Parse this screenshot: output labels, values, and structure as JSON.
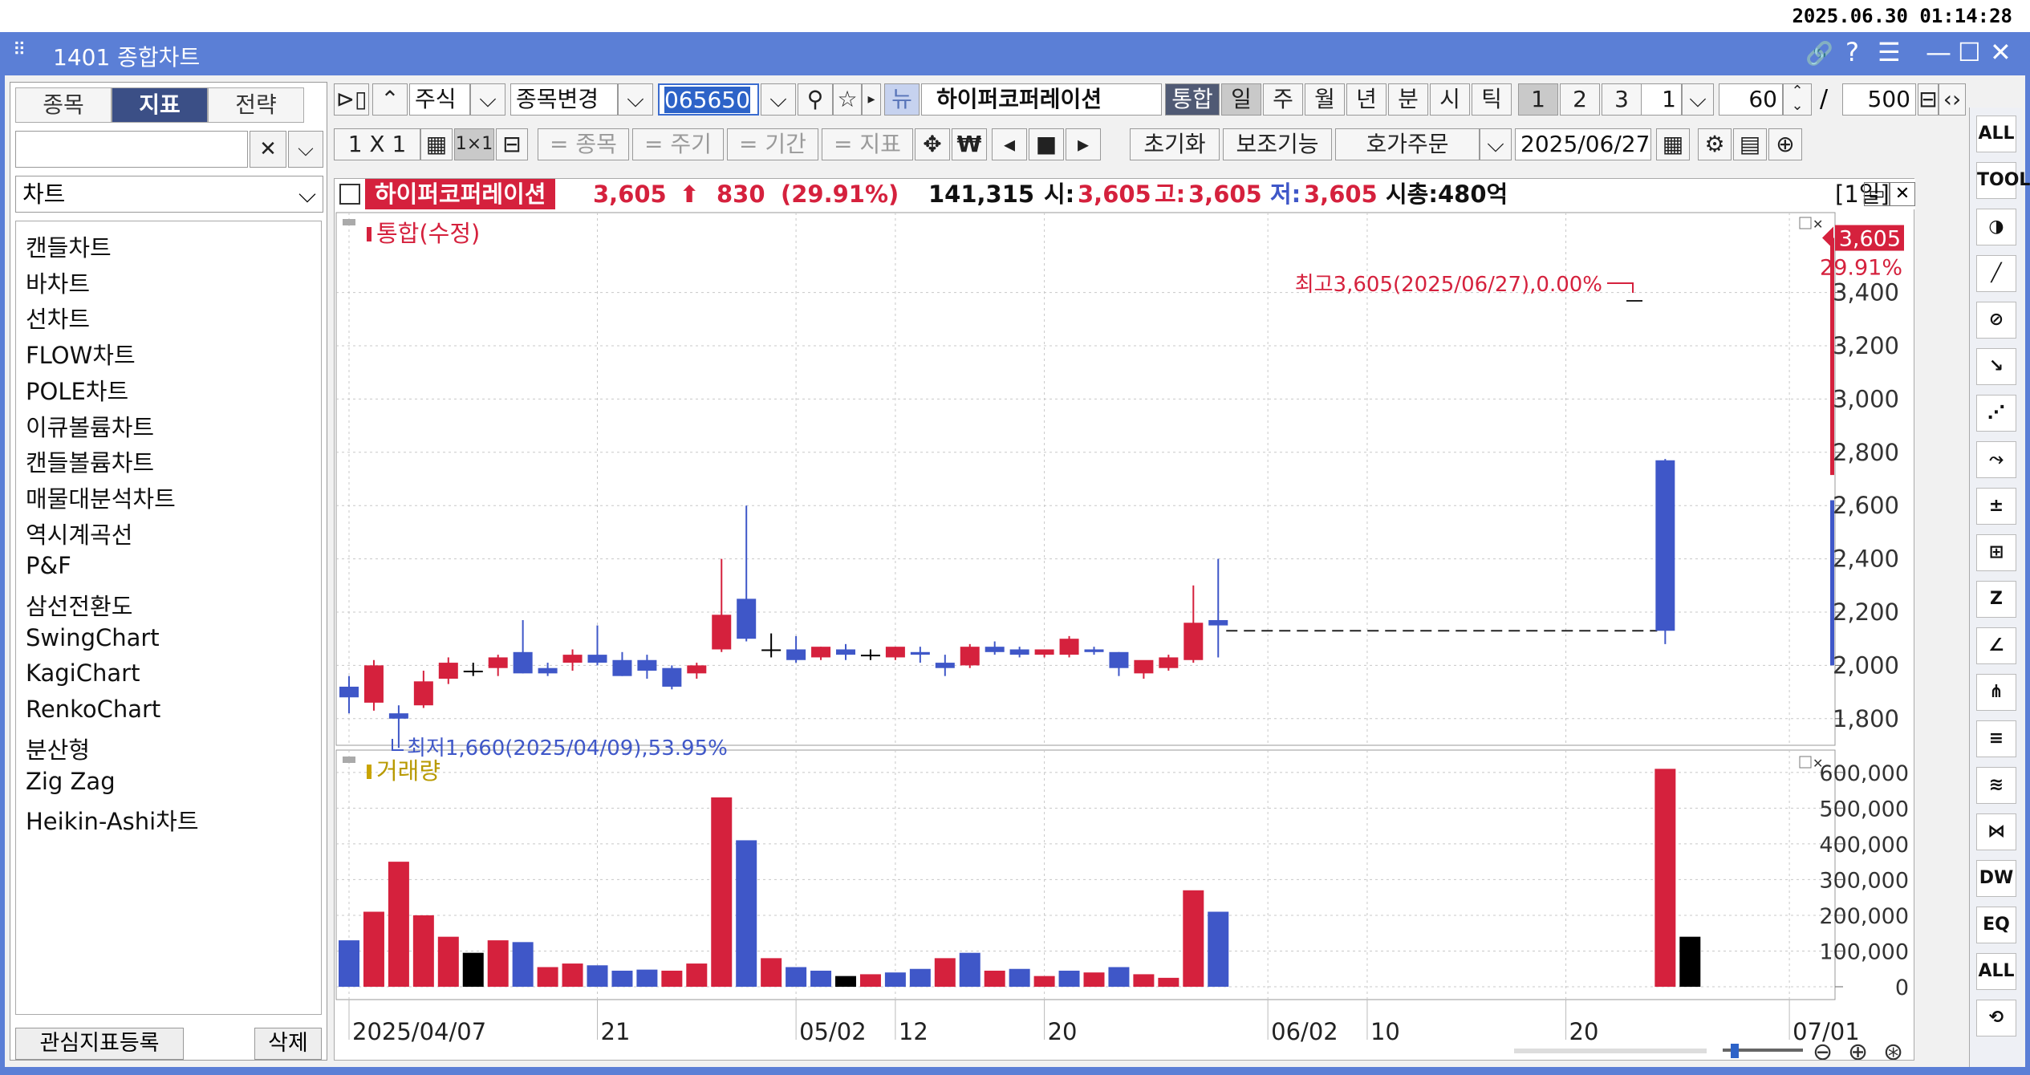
{
  "clock": "2025.06.30 01:14:28",
  "window": {
    "title": "1401 종합차트"
  },
  "left_panel": {
    "tabs": [
      {
        "label": "종목"
      },
      {
        "label": "지표"
      },
      {
        "label": "전략"
      }
    ],
    "search_value": "",
    "category": "차트",
    "chart_types": [
      "캔들차트",
      "바차트",
      "선차트",
      "FLOW차트",
      "POLE차트",
      "이큐볼륨차트",
      "캔들볼륨차트",
      "매물대분석차트",
      "역시계곡선",
      "P&F",
      "삼선전환도",
      "SwingChart",
      "KagiChart",
      "RenkoChart",
      "분산형",
      "Zig Zag",
      "Heikin-Ashi차트"
    ],
    "register_label": "관심지표등록",
    "delete_label": "삭제"
  },
  "toolbar1": {
    "market": "주식",
    "change_label": "종목변경",
    "code": "065650",
    "news": "뉴",
    "stock_name": "하이퍼코퍼레이션",
    "tonghap": "통합",
    "periods": [
      "일",
      "주",
      "월",
      "년",
      "분",
      "시",
      "틱"
    ],
    "nums": [
      "1",
      "2",
      "3"
    ],
    "count": "1",
    "span": "60",
    "slash": "/",
    "total": "500"
  },
  "toolbar2": {
    "layout": "1 X 1",
    "one": "1×1",
    "filters": [
      "종목",
      "주기",
      "기간",
      "지표"
    ],
    "won": "₩",
    "reset": "초기화",
    "aux": "보조기능",
    "order": "호가주문",
    "date": "2025/06/27"
  },
  "info": {
    "name": "하이퍼코퍼레이션",
    "price": "3,605",
    "arrow": "⬆",
    "change": "830",
    "pct": "(29.91%)",
    "volume": "141,315",
    "open_label": "시:",
    "open": "3,605",
    "high_label": "고:",
    "high": "3,605",
    "low_label": "저:",
    "low": "3,605",
    "cap": "시총:480억",
    "period": "[1일]"
  },
  "price_panel": {
    "label": "통합(수정)",
    "max_note": "최고3,605(2025/06/27),0.00%",
    "min_note": "최저1,660(2025/04/09),53.95%",
    "last_price": "3,605",
    "last_pct": "29.91%",
    "y_ticks": [
      1800,
      2000,
      2200,
      2400,
      2600,
      2800,
      3000,
      3200,
      3400
    ],
    "y_tick_labels": [
      "1,800",
      "2,000",
      "2,200",
      "2,400",
      "2,600",
      "2,800",
      "3,000",
      "3,200",
      "3,400"
    ]
  },
  "volume_panel": {
    "label": "거래량",
    "y_ticks": [
      0,
      100000,
      200000,
      300000,
      400000,
      500000,
      600000
    ],
    "y_tick_labels": [
      "0",
      "100,000",
      "200,000",
      "300,000",
      "400,000",
      "500,000",
      "600,000"
    ]
  },
  "x_axis_labels": [
    {
      "i": 0,
      "text": "2025/04/07"
    },
    {
      "i": 10,
      "text": "21"
    },
    {
      "i": 18,
      "text": "05/02"
    },
    {
      "i": 22,
      "text": "12"
    },
    {
      "i": 28,
      "text": "20"
    },
    {
      "i": 37,
      "text": "06/02"
    },
    {
      "i": 41,
      "text": "10"
    },
    {
      "i": 49,
      "text": "20"
    },
    {
      "i": 58,
      "text": "07/01"
    }
  ],
  "colors": {
    "up": "#d5213d",
    "down": "#3f57c8",
    "flat": "#000000",
    "accent": "#5b7fd6",
    "panel_dark": "#3b4f86"
  },
  "right_tools": [
    "ALL",
    "TOOL",
    "◑",
    "╱",
    "⊘",
    "↘",
    "⋰",
    "⤳",
    "±",
    "⊞",
    "Z",
    "∠",
    "⋔",
    "≡",
    "≋",
    "⋈",
    "DW",
    "EQ",
    "ALL",
    "⟲"
  ],
  "chart_data": {
    "type": "candlestick",
    "xlabel": "",
    "ylabel": "",
    "ylim": [
      1700,
      3700
    ],
    "volume_ylim": [
      0,
      640000
    ],
    "x_dates": [
      "2025/04/07",
      "04/08",
      "04/09",
      "04/10",
      "04/11",
      "04/14",
      "04/15",
      "04/16",
      "04/17",
      "04/18",
      "04/21",
      "04/22",
      "04/23",
      "04/24",
      "04/25",
      "04/28",
      "04/29",
      "04/30",
      "05/02",
      "05/07",
      "05/08",
      "05/09",
      "05/12",
      "05/13",
      "05/14",
      "05/15",
      "05/16",
      "05/19",
      "05/20",
      "05/21",
      "05/22",
      "05/23",
      "05/26",
      "05/27",
      "05/28",
      "05/29",
      "05/30",
      "06/02",
      "06/04",
      "06/05",
      "06/09",
      "06/10",
      "06/11",
      "06/12",
      "06/13",
      "06/16",
      "06/17",
      "06/18",
      "06/19",
      "06/20",
      "06/23",
      "06/24",
      "06/25",
      "06/26",
      "06/27",
      "06/30",
      "07/01"
    ],
    "candles": [
      {
        "o": 1920,
        "h": 1960,
        "l": 1820,
        "c": 1880
      },
      {
        "o": 1860,
        "h": 2020,
        "l": 1830,
        "c": 2000
      },
      {
        "o": 1820,
        "h": 1850,
        "l": 1690,
        "c": 1800
      },
      {
        "o": 1850,
        "h": 1980,
        "l": 1840,
        "c": 1940
      },
      {
        "o": 1950,
        "h": 2030,
        "l": 1930,
        "c": 2010
      },
      {
        "o": 1980,
        "h": 2010,
        "l": 1960,
        "c": 1980
      },
      {
        "o": 1990,
        "h": 2040,
        "l": 1960,
        "c": 2030
      },
      {
        "o": 2050,
        "h": 2170,
        "l": 1970,
        "c": 1970
      },
      {
        "o": 1990,
        "h": 2010,
        "l": 1960,
        "c": 1970
      },
      {
        "o": 2010,
        "h": 2060,
        "l": 1980,
        "c": 2040
      },
      {
        "o": 2040,
        "h": 2150,
        "l": 2000,
        "c": 2010
      },
      {
        "o": 2020,
        "h": 2050,
        "l": 1960,
        "c": 1960
      },
      {
        "o": 2020,
        "h": 2040,
        "l": 1950,
        "c": 1980
      },
      {
        "o": 1990,
        "h": 2000,
        "l": 1910,
        "c": 1920
      },
      {
        "o": 1970,
        "h": 2010,
        "l": 1950,
        "c": 2000
      },
      {
        "o": 2060,
        "h": 2400,
        "l": 2050,
        "c": 2190
      },
      {
        "o": 2250,
        "h": 2600,
        "l": 2090,
        "c": 2100
      },
      {
        "o": 2060,
        "h": 2120,
        "l": 2030,
        "c": 2060
      },
      {
        "o": 2060,
        "h": 2110,
        "l": 2010,
        "c": 2020
      },
      {
        "o": 2030,
        "h": 2070,
        "l": 2020,
        "c": 2070
      },
      {
        "o": 2060,
        "h": 2080,
        "l": 2020,
        "c": 2040
      },
      {
        "o": 2040,
        "h": 2060,
        "l": 2020,
        "c": 2040
      },
      {
        "o": 2030,
        "h": 2070,
        "l": 2020,
        "c": 2070
      },
      {
        "o": 2050,
        "h": 2070,
        "l": 2010,
        "c": 2040
      },
      {
        "o": 2010,
        "h": 2040,
        "l": 1960,
        "c": 1990
      },
      {
        "o": 2000,
        "h": 2080,
        "l": 1990,
        "c": 2070
      },
      {
        "o": 2070,
        "h": 2090,
        "l": 2040,
        "c": 2050
      },
      {
        "o": 2060,
        "h": 2070,
        "l": 2030,
        "c": 2040
      },
      {
        "o": 2040,
        "h": 2060,
        "l": 2030,
        "c": 2060
      },
      {
        "o": 2040,
        "h": 2110,
        "l": 2030,
        "c": 2100
      },
      {
        "o": 2060,
        "h": 2070,
        "l": 2040,
        "c": 2050
      },
      {
        "o": 2050,
        "h": 2050,
        "l": 1960,
        "c": 1990
      },
      {
        "o": 1970,
        "h": 2010,
        "l": 1950,
        "c": 2020
      },
      {
        "o": 1990,
        "h": 2040,
        "l": 1980,
        "c": 2030
      },
      {
        "o": 2020,
        "h": 2300,
        "l": 2010,
        "c": 2160
      },
      {
        "o": 2170,
        "h": 2400,
        "l": 2030,
        "c": 2150
      },
      {
        "o": 2770,
        "h": 2775,
        "l": 2080,
        "c": 2130
      }
    ],
    "candle_index": [
      0,
      1,
      2,
      3,
      4,
      5,
      6,
      7,
      8,
      9,
      10,
      11,
      12,
      13,
      14,
      15,
      16,
      17,
      18,
      19,
      20,
      21,
      22,
      23,
      24,
      25,
      26,
      27,
      28,
      29,
      30,
      31,
      32,
      33,
      34,
      35,
      53
    ],
    "volumes": [
      130000,
      210000,
      350000,
      200000,
      140000,
      95000,
      130000,
      125000,
      55000,
      65000,
      60000,
      45000,
      48000,
      45000,
      65000,
      530000,
      410000,
      80000,
      55000,
      45000,
      30000,
      35000,
      40000,
      50000,
      80000,
      95000,
      45000,
      50000,
      30000,
      45000,
      40000,
      55000,
      35000,
      25000,
      270000,
      210000,
      610000,
      140000
    ],
    "volume_index": [
      0,
      1,
      2,
      3,
      4,
      5,
      6,
      7,
      8,
      9,
      10,
      11,
      12,
      13,
      14,
      15,
      16,
      17,
      18,
      19,
      20,
      21,
      22,
      23,
      24,
      25,
      26,
      27,
      28,
      29,
      30,
      31,
      32,
      33,
      34,
      35,
      53,
      54
    ],
    "volume_dirs": [
      "d",
      "u",
      "u",
      "u",
      "u",
      "f",
      "u",
      "d",
      "u",
      "u",
      "d",
      "d",
      "d",
      "u",
      "u",
      "u",
      "d",
      "u",
      "d",
      "d",
      "f",
      "u",
      "d",
      "d",
      "u",
      "d",
      "u",
      "d",
      "u",
      "d",
      "u",
      "d",
      "u",
      "u",
      "u",
      "d",
      "u",
      "f"
    ],
    "baseline_price": 2130
  }
}
